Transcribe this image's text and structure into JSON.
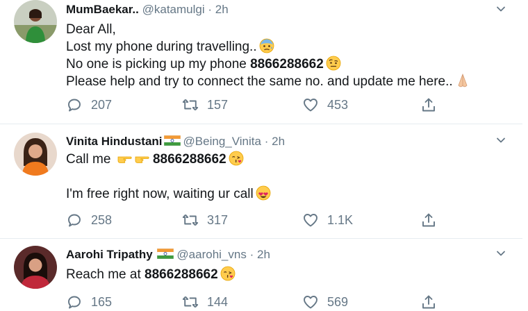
{
  "tweets": [
    {
      "name": "MumBaekar..",
      "handle": "@katamulgi",
      "dot": "·",
      "time": "2h",
      "lines": [
        "Dear All,",
        "Lost my phone during travelling..",
        "No one is picking up my phone ",
        "Please help and try to connect the same no. and update me here.."
      ],
      "phone": "8866288662",
      "counts": {
        "replies": "207",
        "retweets": "157",
        "likes": "453"
      },
      "emojis": [
        "anxious-face",
        "face-with-raised-eyebrow",
        "folded-hands"
      ]
    },
    {
      "name": "Vinita Hindustani",
      "handle": "@Being_Vinita",
      "dot": "·",
      "time": "2h",
      "lines": [
        "Call me ",
        "I'm free right now, waiting ur call"
      ],
      "phone": "8866288662",
      "counts": {
        "replies": "258",
        "retweets": "317",
        "likes": "1.1K"
      },
      "emojis": [
        "pointing-right",
        "pointing-right",
        "face-blowing-kiss",
        "heart-eyes"
      ]
    },
    {
      "name": "Aarohi Tripathy",
      "handle": "@aarohi_vns",
      "dot": "·",
      "time": "2h",
      "lines": [
        "Reach me at "
      ],
      "phone": "8866288662",
      "counts": {
        "replies": "165",
        "retweets": "144",
        "likes": "569"
      },
      "emojis": [
        "face-blowing-kiss"
      ]
    }
  ],
  "colors": {
    "text": "#14171a",
    "muted": "#657786",
    "divider": "#e6ecf0",
    "icon": "#657786"
  },
  "icons": [
    "reply-icon",
    "retweet-icon",
    "like-icon",
    "share-icon",
    "chevron-down-icon",
    "india-flag-icon"
  ]
}
